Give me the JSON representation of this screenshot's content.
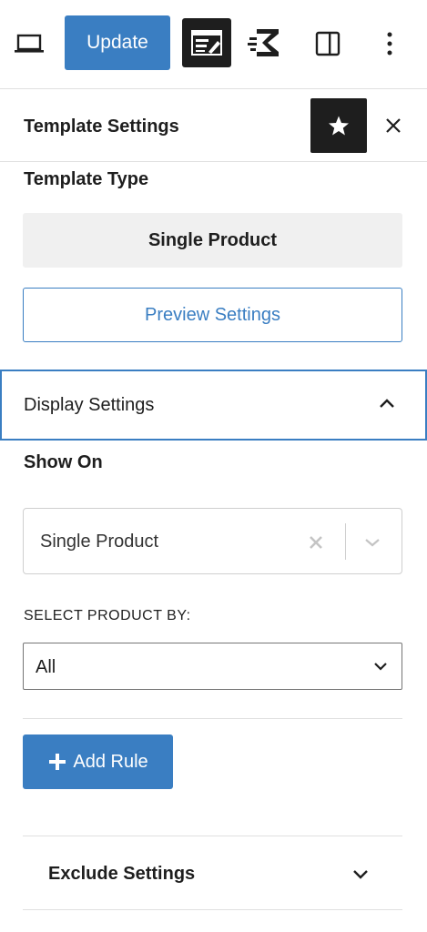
{
  "toolbar": {
    "update_label": "Update",
    "icons": [
      "laptop-icon",
      "editor-icon",
      "plugin-logo-icon",
      "sidebar-toggle-icon",
      "more-vertical-icon"
    ]
  },
  "panel": {
    "title": "Template Settings",
    "icons": [
      "star-icon",
      "close-icon"
    ]
  },
  "template_type": {
    "label": "Template Type",
    "value": "Single Product"
  },
  "preview_button": "Preview Settings",
  "display_settings": {
    "label": "Display Settings",
    "expanded": true,
    "show_on_label": "Show On",
    "show_on_value": "Single Product",
    "select_product_label": "SELECT PRODUCT BY:",
    "select_product_value": "All",
    "add_rule_label": "Add Rule"
  },
  "exclude_settings": {
    "label": "Exclude Settings",
    "expanded": false
  },
  "colors": {
    "accent": "#3a7ec2",
    "dark": "#1e1e1e",
    "light_bg": "#f0f0f0",
    "border": "#e0e0e0"
  }
}
